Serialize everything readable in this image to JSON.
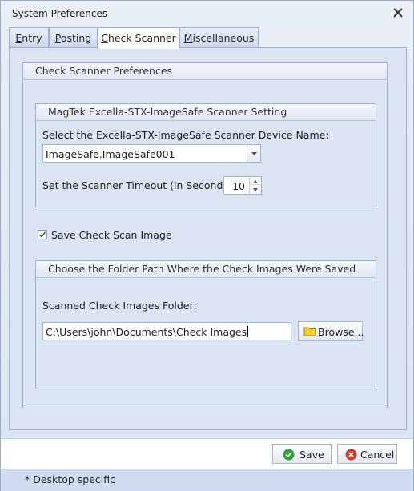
{
  "window": {
    "title": "System Preferences"
  },
  "tabs": [
    {
      "label": "Entry",
      "underline": "E"
    },
    {
      "label": "Posting",
      "underline": "P"
    },
    {
      "label": "Check Scanner",
      "underline": "C"
    },
    {
      "label": "Miscellaneous",
      "underline": "M"
    }
  ],
  "active_tab": "Check Scanner",
  "check_scanner": {
    "group_title": "Check Scanner Preferences",
    "device_group": {
      "title": "MagTek Excella-STX-ImageSafe Scanner Setting",
      "device_label": "Select the Excella-STX-ImageSafe Scanner Device Name:",
      "device_value": "ImageSafe.ImageSafe001",
      "timeout_label": "Set the Scanner Timeout (in Seconds):",
      "timeout_value": "10"
    },
    "save_image": {
      "label": "Save Check Scan Image",
      "checked": true
    },
    "folder_group": {
      "title": "Choose the Folder Path Where the Check Images Were Saved",
      "folder_label": "Scanned Check Images Folder:",
      "folder_value": "C:\\Users\\john\\Documents\\Check Images",
      "browse_label": "Browse..."
    }
  },
  "footer": {
    "save_label": "Save",
    "cancel_label": "Cancel"
  },
  "status": {
    "text": "* Desktop specific"
  },
  "colors": {
    "save_icon": "#2fa33b",
    "cancel_icon": "#d23a2a",
    "folder_icon": "#f2cf2b"
  }
}
